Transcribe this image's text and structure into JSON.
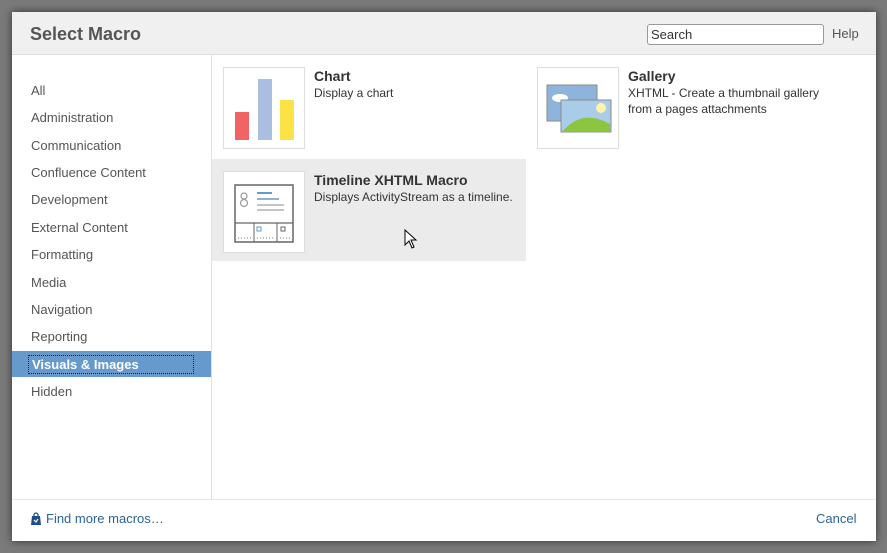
{
  "dialog": {
    "title": "Select Macro"
  },
  "header": {
    "search_placeholder": "Search",
    "help_label": "Help"
  },
  "sidebar": {
    "categories": [
      {
        "label": "All"
      },
      {
        "label": "Administration"
      },
      {
        "label": "Communication"
      },
      {
        "label": "Confluence Content"
      },
      {
        "label": "Development"
      },
      {
        "label": "External Content"
      },
      {
        "label": "Formatting"
      },
      {
        "label": "Media"
      },
      {
        "label": "Navigation"
      },
      {
        "label": "Reporting"
      },
      {
        "label": "Visuals & Images",
        "selected": true
      },
      {
        "label": "Hidden"
      }
    ]
  },
  "macros": [
    {
      "name": "Chart",
      "description": "Display a chart",
      "icon": "bar-chart-icon"
    },
    {
      "name": "Gallery",
      "description": "XHTML - Create a thumbnail gallery from a pages attachments",
      "icon": "gallery-icon"
    },
    {
      "name": "Timeline XHTML Macro",
      "description": "Displays ActivityStream as a timeline.",
      "icon": "timeline-icon",
      "highlighted": true
    }
  ],
  "footer": {
    "find_more_label": "Find more macros…",
    "cancel_label": "Cancel"
  },
  "colors": {
    "selected_category_bg": "#6699cc",
    "link": "#2a6496",
    "hover_tile_bg": "#ebebeb"
  }
}
